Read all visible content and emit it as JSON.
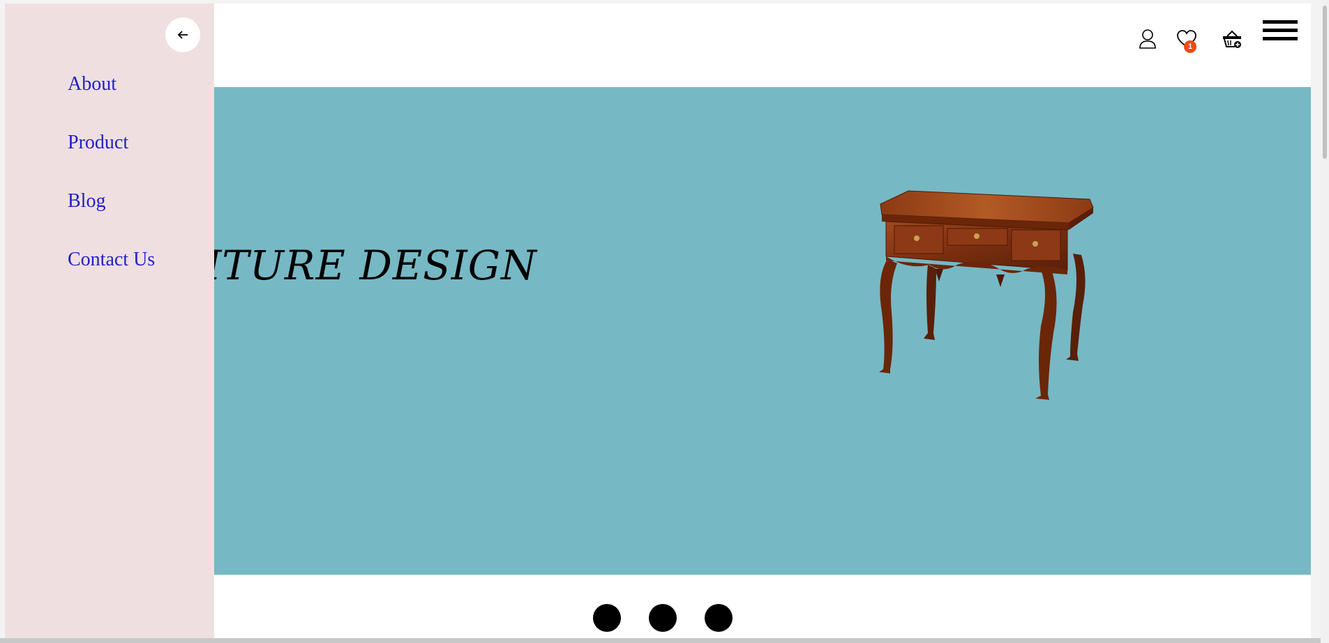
{
  "header": {
    "icons": [
      {
        "name": "user-icon"
      },
      {
        "name": "heart-icon",
        "badge": "1"
      },
      {
        "name": "basket-icon"
      }
    ],
    "menu_icon": "hamburger-icon"
  },
  "hero": {
    "title": "ST FURNITURE DESIGN",
    "background": "#77b8c5"
  },
  "sidebar": {
    "background": "#efdfe1",
    "close_icon": "arrow-left-icon",
    "items": [
      {
        "label": "About"
      },
      {
        "label": "Product"
      },
      {
        "label": "Blog"
      },
      {
        "label": "Contact Us"
      }
    ]
  },
  "carousel": {
    "dot_count": 3
  },
  "colors": {
    "link": "#1f1fc8",
    "badge": "#ef4b12"
  }
}
